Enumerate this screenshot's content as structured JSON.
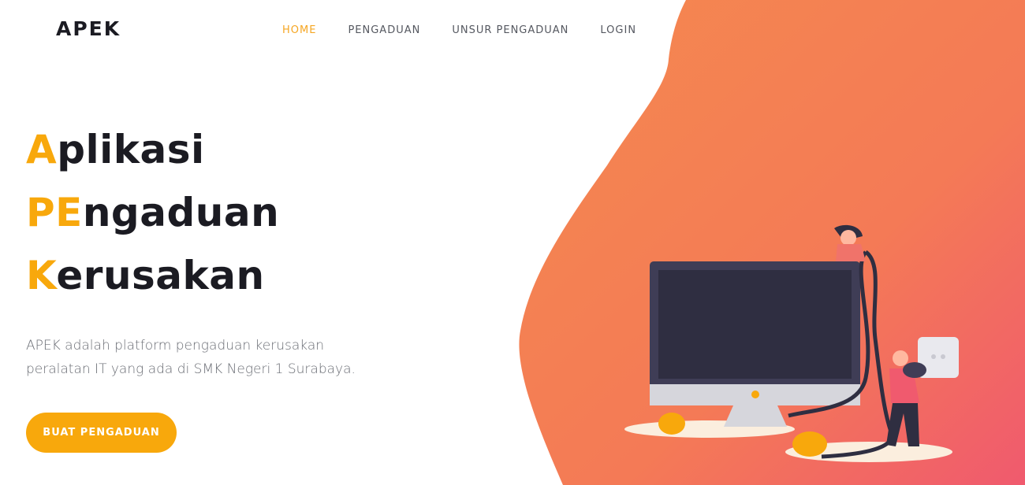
{
  "brand": "APEK",
  "nav": {
    "items": [
      {
        "label": "HOME",
        "active": true
      },
      {
        "label": "PENGADUAN",
        "active": false
      },
      {
        "label": "UNSUR PENGADUAN",
        "active": false
      },
      {
        "label": "LOGIN",
        "active": false
      }
    ]
  },
  "hero": {
    "line1": {
      "accent": "A",
      "rest": "plikasi"
    },
    "line2": {
      "accent": "PE",
      "rest": "ngaduan"
    },
    "line3": {
      "accent": "K",
      "rest": "erusakan"
    }
  },
  "description": "APEK adalah platform pengaduan kerusakan peralatan IT yang ada di SMK Negeri 1 Surabaya.",
  "cta": {
    "label": "BUAT PENGADUAN"
  },
  "colors": {
    "accent": "#f8a80c",
    "gradient_start": "#f5894f",
    "gradient_end": "#f05a6e",
    "dark_text": "#1b1b22",
    "nav_text": "#555860",
    "nav_active": "#f5a623"
  }
}
